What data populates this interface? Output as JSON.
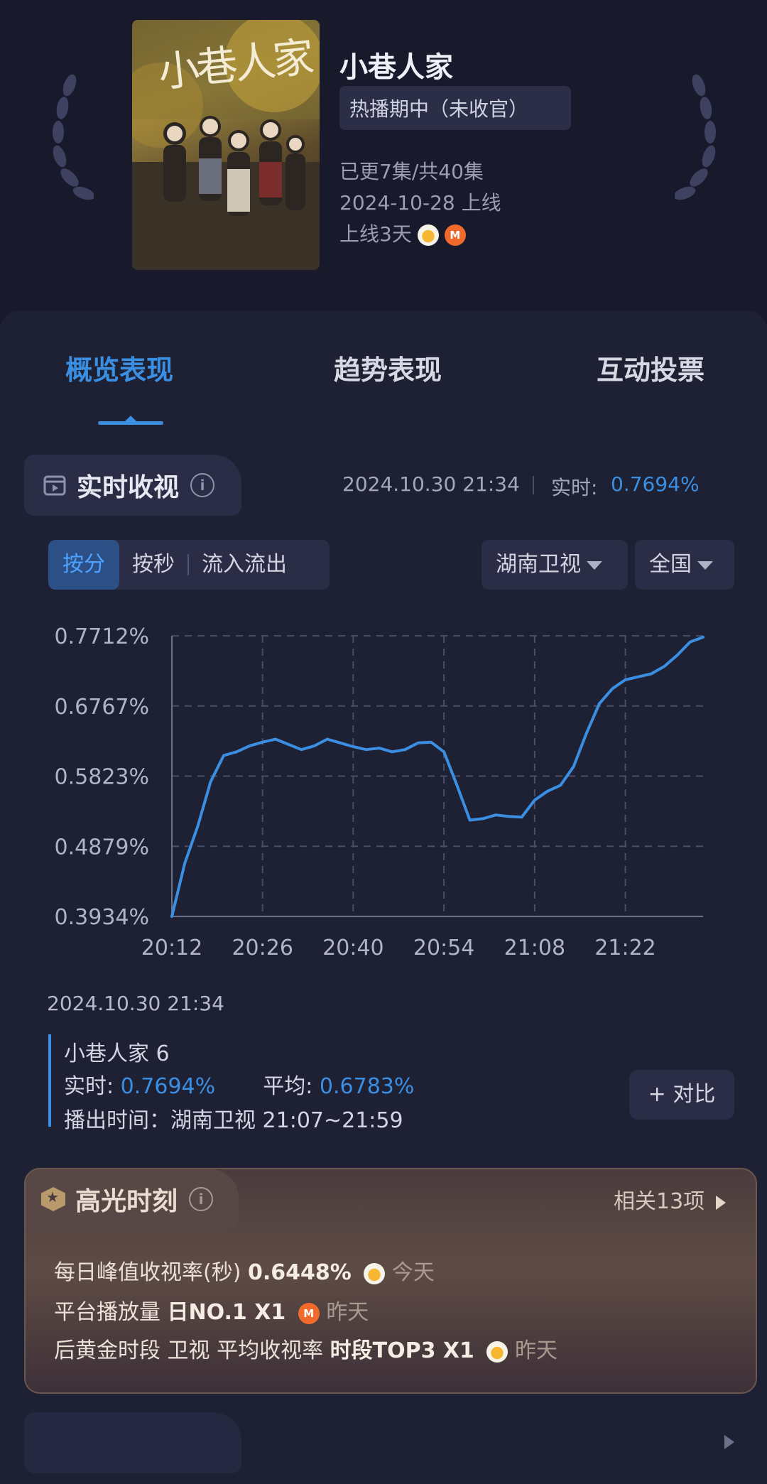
{
  "show": {
    "title": "小巷人家",
    "status": "热播期中（未收官）",
    "episodes": "已更7集/共40集",
    "release": "2024-10-28 上线",
    "days_online": "上线3天",
    "poster_calligraphy": "小巷人家",
    "platform_icons": [
      "mango-tv-icon",
      "mgtv-icon"
    ]
  },
  "tabs": [
    {
      "label": "概览表现",
      "active": true
    },
    {
      "label": "趋势表现",
      "active": false
    },
    {
      "label": "互动投票",
      "active": false
    }
  ],
  "realtime": {
    "title": "实时收视",
    "timestamp": "2024.10.30 21:34",
    "realtime_label": "实时:",
    "realtime_value": "0.7694%"
  },
  "filters": {
    "segments": [
      {
        "label": "按分",
        "active": true
      },
      {
        "label": "按秒",
        "active": false
      },
      {
        "label": "流入流出",
        "active": false
      }
    ],
    "channel": "湖南卫视",
    "region": "全国"
  },
  "chart_data": {
    "type": "line",
    "y_ticks": [
      "0.7712%",
      "0.6767%",
      "0.5823%",
      "0.4879%",
      "0.3934%"
    ],
    "x_ticks": [
      "20:12",
      "20:26",
      "20:40",
      "20:54",
      "21:08",
      "21:22"
    ],
    "ylim": [
      0.3934,
      0.7712
    ],
    "xlim": [
      "20:12",
      "21:34"
    ],
    "grid": true,
    "color": "#3b8fe3",
    "series": [
      {
        "x": [
          "20:12",
          "20:14",
          "20:16",
          "20:18",
          "20:20",
          "20:22",
          "20:24",
          "20:26",
          "20:28",
          "20:30",
          "20:32",
          "20:34",
          "20:36",
          "20:38",
          "20:40",
          "20:42",
          "20:44",
          "20:46",
          "20:48",
          "20:50",
          "20:52",
          "20:54",
          "20:56",
          "20:58",
          "21:00",
          "21:02",
          "21:04",
          "21:06",
          "21:08",
          "21:10",
          "21:12",
          "21:14",
          "21:16",
          "21:18",
          "21:20",
          "21:22",
          "21:24",
          "21:26",
          "21:28",
          "21:30",
          "21:32",
          "21:34"
        ],
        "y": [
          0.3934,
          0.465,
          0.515,
          0.575,
          0.61,
          0.615,
          0.623,
          0.628,
          0.632,
          0.625,
          0.618,
          0.623,
          0.632,
          0.627,
          0.622,
          0.618,
          0.62,
          0.615,
          0.618,
          0.627,
          0.628,
          0.615,
          0.57,
          0.523,
          0.525,
          0.53,
          0.528,
          0.527,
          0.55,
          0.562,
          0.57,
          0.595,
          0.64,
          0.68,
          0.7,
          0.712,
          0.716,
          0.72,
          0.73,
          0.745,
          0.763,
          0.7694
        ]
      }
    ]
  },
  "episode": {
    "timestamp": "2024.10.30 21:34",
    "name": "小巷人家 6",
    "realtime_label": "实时:",
    "realtime_value": "0.7694%",
    "avg_label": "平均:",
    "avg_value": "0.6783%",
    "airtime": "播出时间：湖南卫视 21:07~21:59",
    "compare_label": "+ 对比"
  },
  "highlights": {
    "title": "高光时刻",
    "related": "相关13项",
    "rows": [
      {
        "prefix": "每日峰值收视率(秒)",
        "bold": "0.6448%",
        "icon": "mango-tv-icon",
        "day": "今天"
      },
      {
        "prefix": "平台播放量",
        "bold": "日NO.1 X1",
        "icon": "mgtv-icon",
        "day": "昨天"
      },
      {
        "prefix": "后黄金时段 卫视 平均收视率",
        "bold": "时段TOP3 X1",
        "icon": "mango-tv-icon",
        "day": "昨天"
      }
    ]
  }
}
